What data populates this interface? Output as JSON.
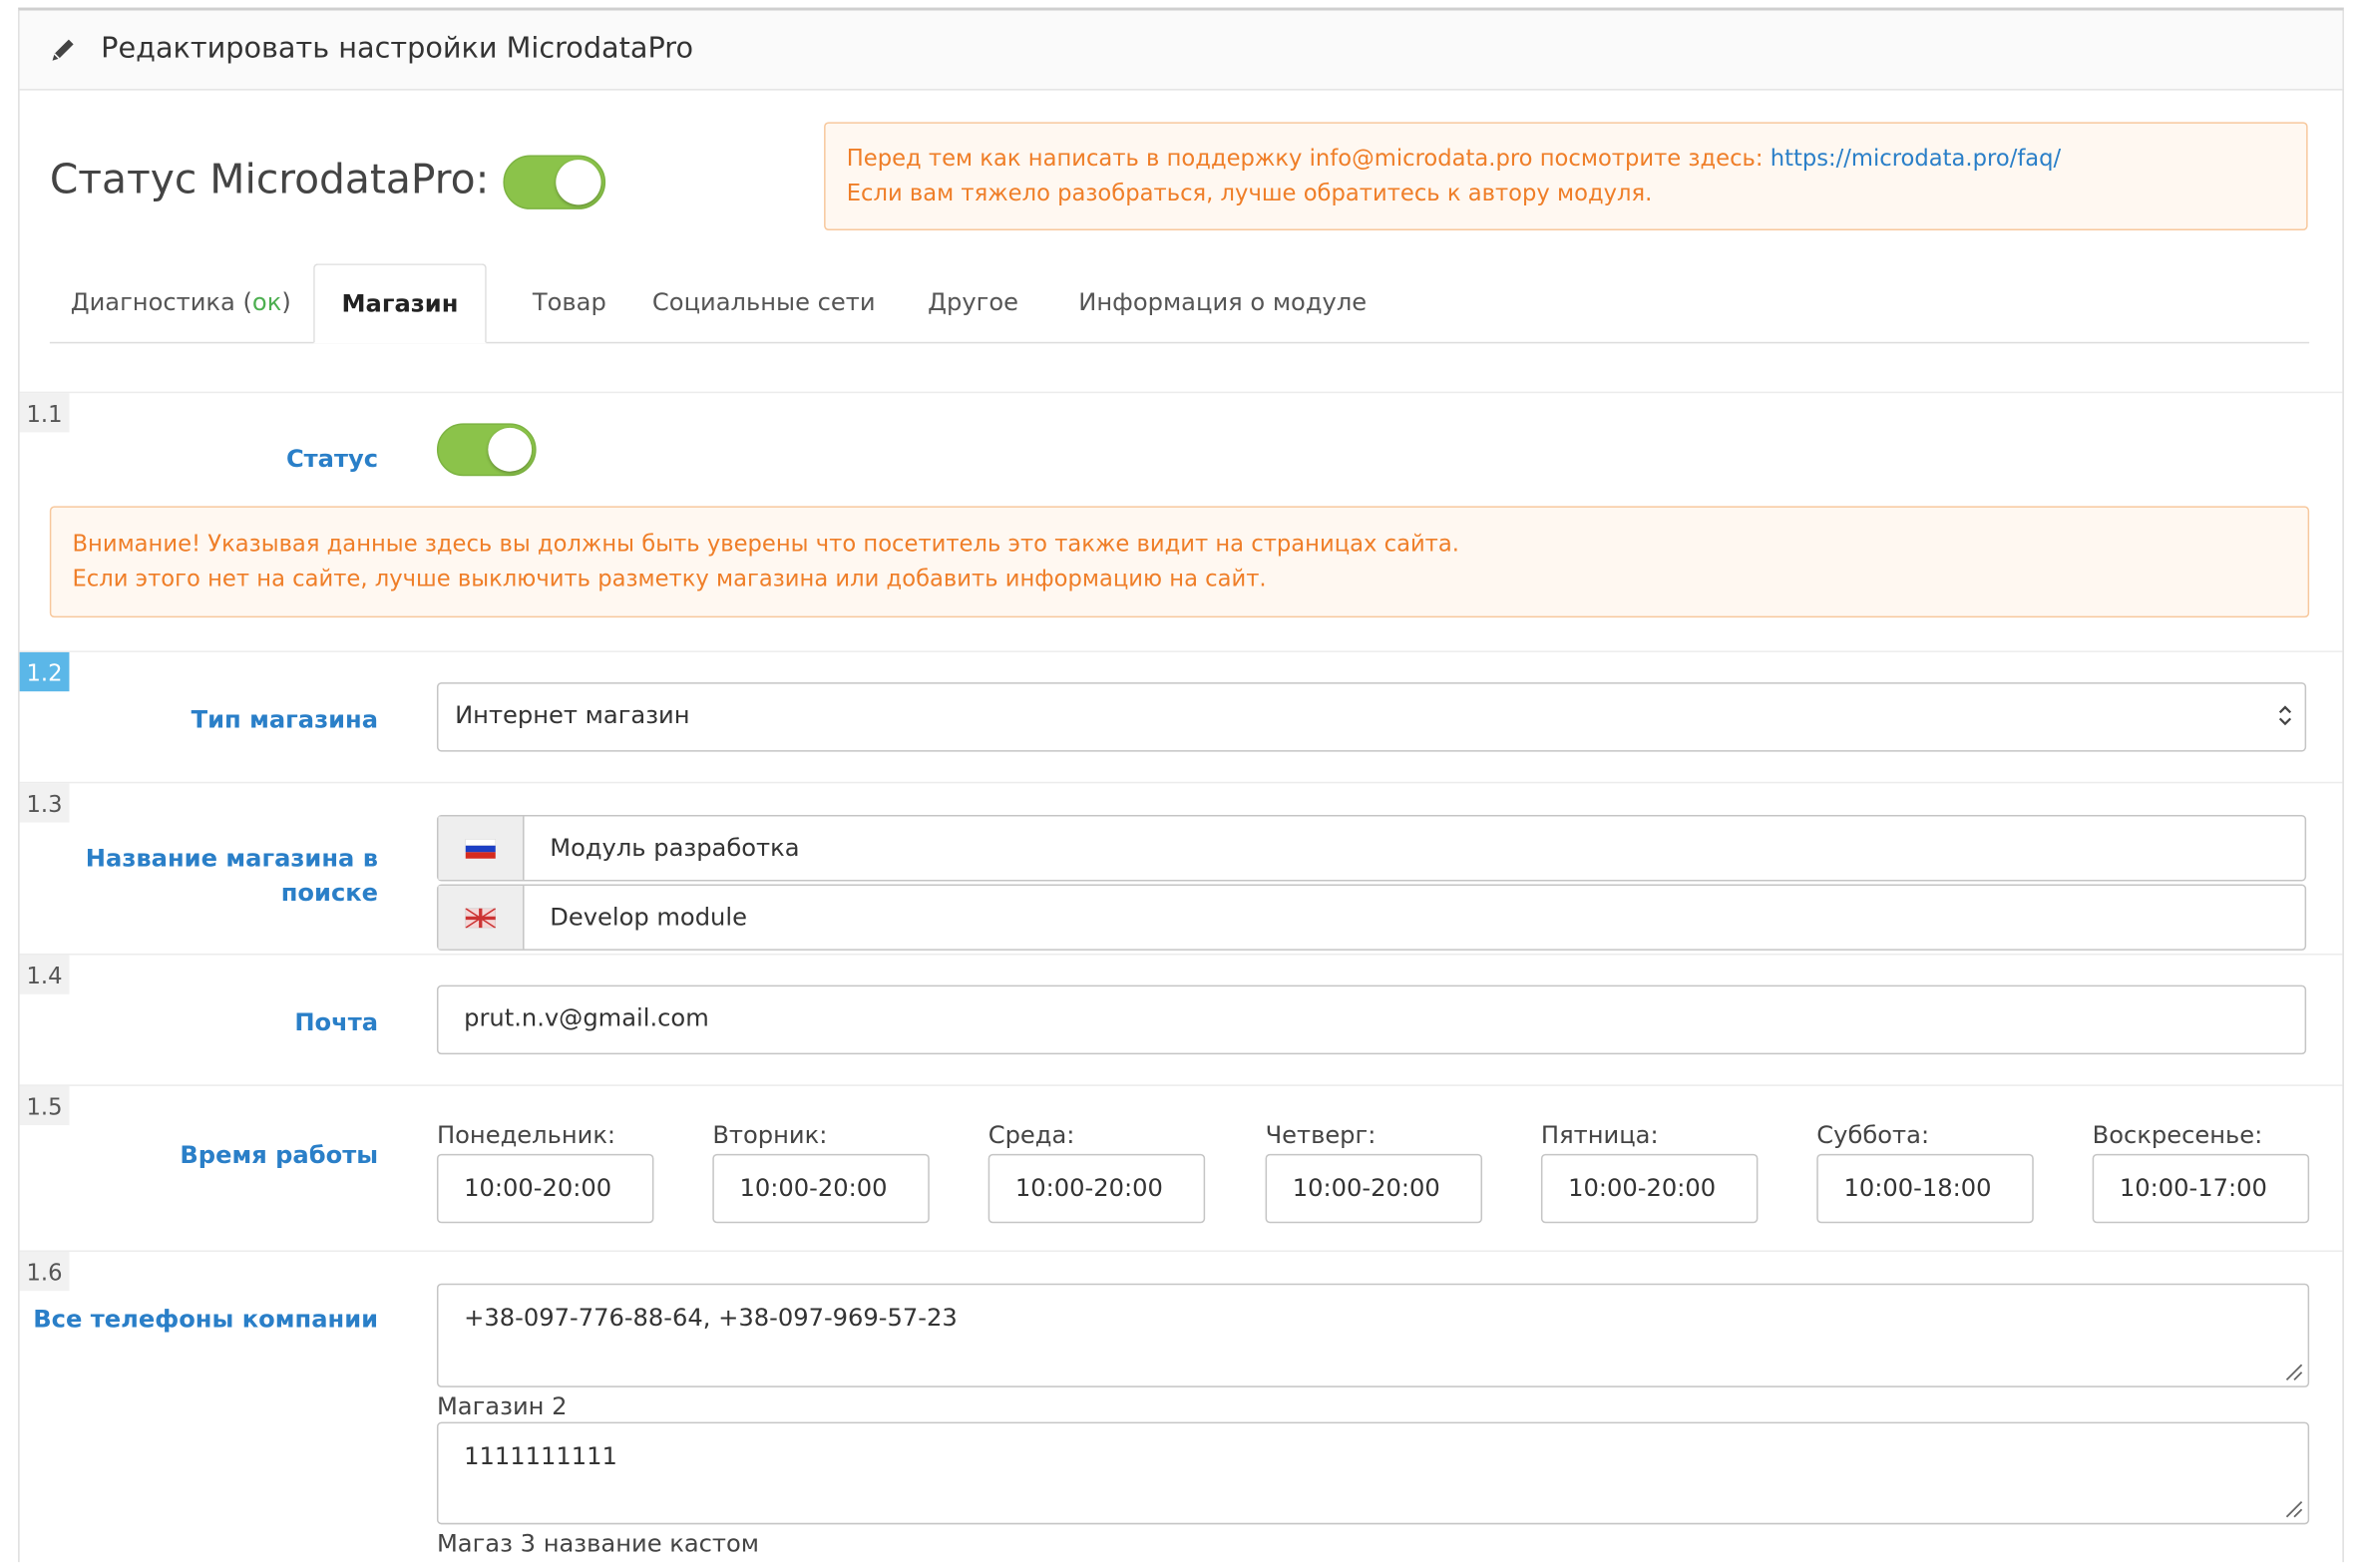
{
  "header": {
    "title": "Редактировать настройки MicrodataPro",
    "icon": "pencil-icon"
  },
  "module_status": {
    "label": "Статус MicrodataPro:",
    "enabled": true
  },
  "support_alert": {
    "text": "Перед тем как написать в поддержку info@microdata.pro посмотрите здесь: ",
    "link": "https://microdata.pro/faq/",
    "line2": "Если вам тяжело разобраться, лучше обратитесь к автору модуля."
  },
  "tabs": [
    {
      "label": "Диагностика (",
      "status": "ок",
      "suffix": ")"
    },
    {
      "label": "Магазин",
      "active": true
    },
    {
      "label": "Товар"
    },
    {
      "label": "Социальные сети"
    },
    {
      "label": "Другое"
    },
    {
      "label": "Информация о модуле"
    }
  ],
  "sections": {
    "s1_1": {
      "num": "1.1",
      "label": "Статус",
      "enabled": true,
      "alert_line1": "Внимание! Указывая данные здесь вы должны быть уверены что посетитель это также видит на страницах сайта.",
      "alert_line2": "Если этого нет на сайте, лучше выключить разметку магазина или добавить информацию на сайт."
    },
    "s1_2": {
      "num": "1.2",
      "label": "Тип магазина",
      "value": "Интернет магазин"
    },
    "s1_3": {
      "num": "1.3",
      "label_line1": "Название магазина в",
      "label_line2": "поиске",
      "values": [
        {
          "flag": "ru-flag-icon",
          "value": "Модуль разработка"
        },
        {
          "flag": "en-flag-icon",
          "value": "Develop module"
        }
      ]
    },
    "s1_4": {
      "num": "1.4",
      "label": "Почта",
      "value": "prut.n.v@gmail.com"
    },
    "s1_5": {
      "num": "1.5",
      "label": "Время работы",
      "days": [
        {
          "day": "Понедельник:",
          "hours": "10:00-20:00"
        },
        {
          "day": "Вторник:",
          "hours": "10:00-20:00"
        },
        {
          "day": "Среда:",
          "hours": "10:00-20:00"
        },
        {
          "day": "Четверг:",
          "hours": "10:00-20:00"
        },
        {
          "day": "Пятница:",
          "hours": "10:00-20:00"
        },
        {
          "day": "Суббота:",
          "hours": "10:00-18:00"
        },
        {
          "day": "Воскресенье:",
          "hours": "10:00-17:00"
        }
      ]
    },
    "s1_6": {
      "num": "1.6",
      "label": "Все телефоны компании",
      "phones": "+38-097-776-88-64, +38-097-969-57-23",
      "shop2_label": "Магазин 2",
      "shop2_value": "1111111111",
      "shop3_label": "Магаз 3 название кастом"
    }
  },
  "colors": {
    "accent_blue": "#2a7fc8",
    "toggle_green": "#8bc34a",
    "alert_orange": "#ef7e28",
    "highlight": "#5bb7e8"
  }
}
